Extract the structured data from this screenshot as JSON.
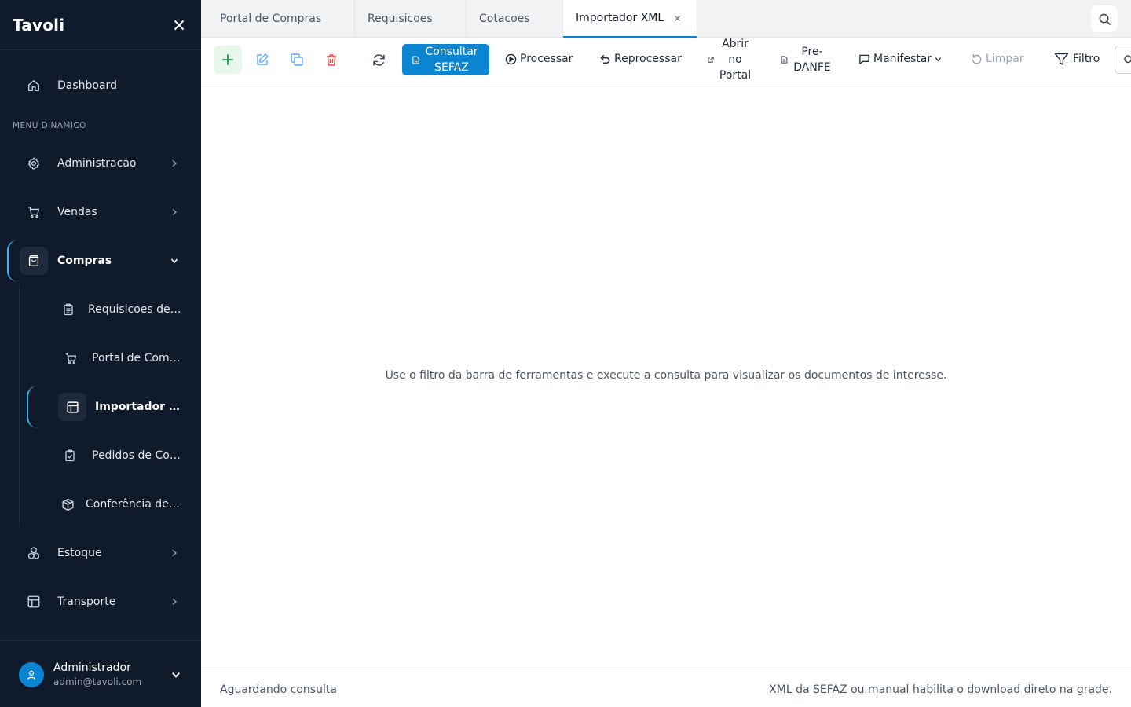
{
  "app": {
    "name": "Tavoli"
  },
  "sidebar": {
    "dashboard": "Dashboard",
    "section_label": "MENU DINAMICO",
    "items": [
      {
        "label": "Administracao",
        "icon": "gear-icon"
      },
      {
        "label": "Vendas",
        "icon": "cart-icon"
      },
      {
        "label": "Compras",
        "icon": "shopping-bag-icon"
      },
      {
        "label": "Estoque",
        "icon": "boxes-icon"
      },
      {
        "label": "Transporte",
        "icon": "layout-icon"
      }
    ],
    "compras_sub": [
      {
        "label": "Requisicoes de Compras",
        "icon": "clipboard-list-icon"
      },
      {
        "label": "Portal de Compras",
        "icon": "cart-icon"
      },
      {
        "label": "Importador XML",
        "icon": "layout-icon"
      },
      {
        "label": "Pedidos de Compras",
        "icon": "clipboard-check-icon"
      },
      {
        "label": "Conferência de Recebimento",
        "icon": "package-icon"
      }
    ],
    "user": {
      "name": "Administrador",
      "email": "admin@tavoli.com"
    }
  },
  "tabs": [
    {
      "label": "Portal de Compras"
    },
    {
      "label": "Requisicoes"
    },
    {
      "label": "Cotacoes"
    },
    {
      "label": "Importador XML",
      "active": true
    }
  ],
  "toolbar": {
    "consultar_sefaz": "Consultar SEFAZ",
    "processar": "Processar",
    "reprocessar": "Reprocessar",
    "abrir_portal": "Abrir no Portal",
    "pre_danfe": "Pre-DANFE",
    "manifestar": "Manifestar",
    "limpar": "Limpar",
    "filtro": "Filtro"
  },
  "content": {
    "empty_message": "Use o filtro da barra de ferramentas e execute a consulta para visualizar os documentos de interesse."
  },
  "status": {
    "left": "Aguardando consulta",
    "right": "XML da SEFAZ ou manual habilita o download direto na grade."
  },
  "colors": {
    "sidebar_bg": "#0f1a2b",
    "primary": "#0b84d1",
    "accent": "#38bdf8",
    "add_green": "#16a34a",
    "edit_blue": "#60a5fa",
    "delete_red": "#ef4444"
  }
}
